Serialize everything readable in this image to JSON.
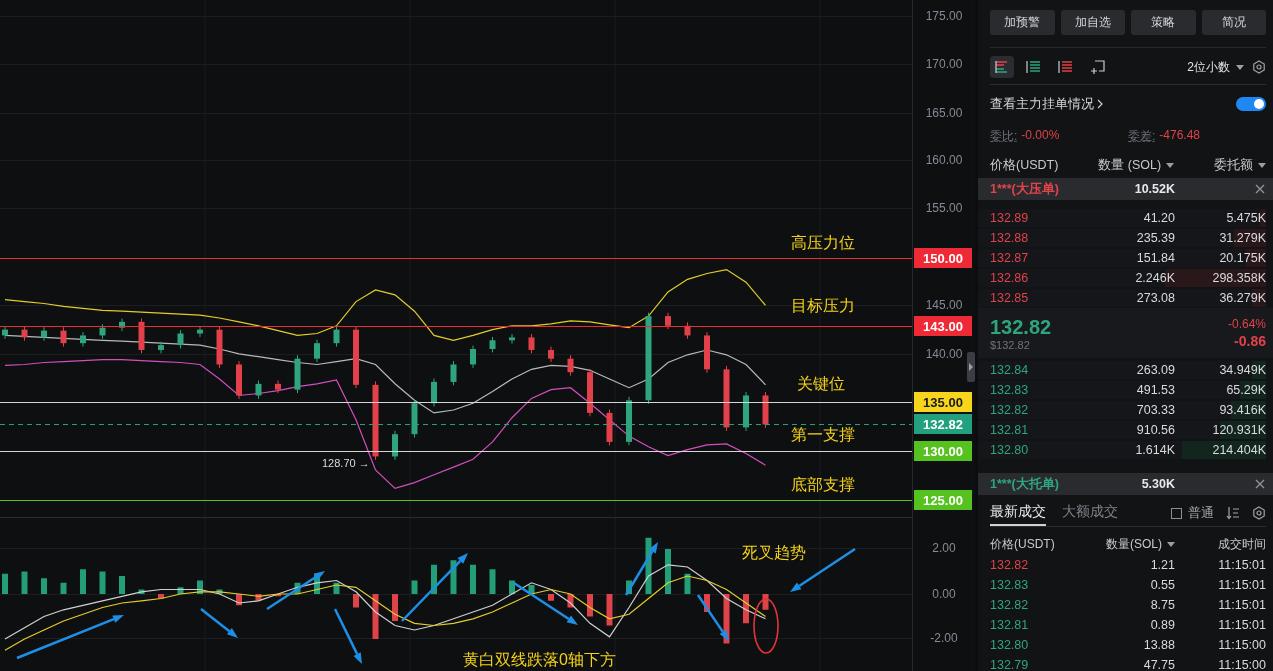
{
  "chart": {
    "price_axis": [
      "175.00",
      "170.00",
      "165.00",
      "160.00",
      "155.00",
      "145.00",
      "140.00"
    ],
    "price_tags": [
      {
        "label": "150.00",
        "color": "#ee2a36"
      },
      {
        "label": "143.00",
        "color": "#ee2a36"
      },
      {
        "label": "135.00",
        "color": "#f6d51c"
      },
      {
        "label": "132.82",
        "color": "#23a07d"
      },
      {
        "label": "130.00",
        "color": "#56c21f"
      },
      {
        "label": "125.00",
        "color": "#56c21f"
      }
    ],
    "notes": [
      "高压力位",
      "目标压力",
      "关键位",
      "第一支撑",
      "底部支撑"
    ],
    "low_label": "128.70 →"
  },
  "macd": {
    "axis": [
      "2.00",
      "0.00",
      "-2.00"
    ],
    "notes": [
      "死叉趋势",
      "黄白双线跌落0轴下方"
    ]
  },
  "side_panel": {
    "actions": [
      "加预警",
      "加自选",
      "策略",
      "简况"
    ],
    "views": [
      {
        "kind": "both",
        "selected": true
      },
      {
        "kind": "bids",
        "selected": false
      },
      {
        "kind": "asks",
        "selected": false
      },
      {
        "kind": "custom",
        "selected": false
      }
    ],
    "precision": "2位小数",
    "main_orders": {
      "label": "查看主力挂单情况",
      "on": true
    },
    "stats": [
      {
        "label": "委比:",
        "value": "-0.00%"
      },
      {
        "label": "委差:",
        "value": "-476.48"
      }
    ],
    "book_columns": [
      {
        "label": "价格(USDT)",
        "sortable": false
      },
      {
        "label": "数量 (SOL)",
        "sortable": true
      },
      {
        "label": "委托额",
        "sortable": true
      }
    ],
    "big_ask": {
      "label": "1***(大压单)",
      "amount": "10.52K"
    },
    "asks": [
      {
        "price": "132.89",
        "amount": "41.20",
        "total": "5.475K",
        "level": 0.02
      },
      {
        "price": "132.88",
        "amount": "235.39",
        "total": "31.279K",
        "level": 0.11
      },
      {
        "price": "132.87",
        "amount": "151.84",
        "total": "20.175K",
        "level": 0.07
      },
      {
        "price": "132.86",
        "amount": "2.246K",
        "total": "298.358K",
        "level": 0.35
      },
      {
        "price": "132.85",
        "amount": "273.08",
        "total": "36.279K",
        "level": 0.05
      }
    ],
    "last": {
      "price": "132.82",
      "usd": "$132.82",
      "change_pct": "-0.64%",
      "change": "-0.86"
    },
    "bids": [
      {
        "price": "132.84",
        "amount": "263.09",
        "total": "34.949K",
        "level": 0.05
      },
      {
        "price": "132.83",
        "amount": "491.53",
        "total": "65.29K",
        "level": 0.09
      },
      {
        "price": "132.82",
        "amount": "703.33",
        "total": "93.416K",
        "level": 0.12
      },
      {
        "price": "132.81",
        "amount": "910.56",
        "total": "120.931K",
        "level": 0.16
      },
      {
        "price": "132.80",
        "amount": "1.614K",
        "total": "214.404K",
        "level": 0.29
      }
    ],
    "big_bid": {
      "label": "1***(大托单)",
      "amount": "5.30K"
    },
    "trade_tabs": [
      {
        "label": "最新成交",
        "selected": true
      },
      {
        "label": "大额成交",
        "selected": false
      }
    ],
    "filter": {
      "label": "普通",
      "checked": false
    },
    "trade_columns": [
      {
        "label": "价格(USDT)",
        "sortable": false
      },
      {
        "label": "数量(SOL)",
        "sortable": true
      },
      {
        "label": "成交时间",
        "sortable": false
      }
    ],
    "trades": [
      {
        "price": "132.82",
        "amount": "1.21",
        "time": "11:15:01",
        "color": "#e0434a"
      },
      {
        "price": "132.83",
        "amount": "0.55",
        "time": "11:15:01",
        "color": "#2ea57f"
      },
      {
        "price": "132.82",
        "amount": "8.75",
        "time": "11:15:01",
        "color": "#2ea57f"
      },
      {
        "price": "132.81",
        "amount": "0.89",
        "time": "11:15:01",
        "color": "#2ea57f"
      },
      {
        "price": "132.80",
        "amount": "13.88",
        "time": "11:15:00",
        "color": "#2ea57f"
      },
      {
        "price": "132.79",
        "amount": "47.75",
        "time": "11:15:00",
        "color": "#2ea57f"
      }
    ]
  }
}
